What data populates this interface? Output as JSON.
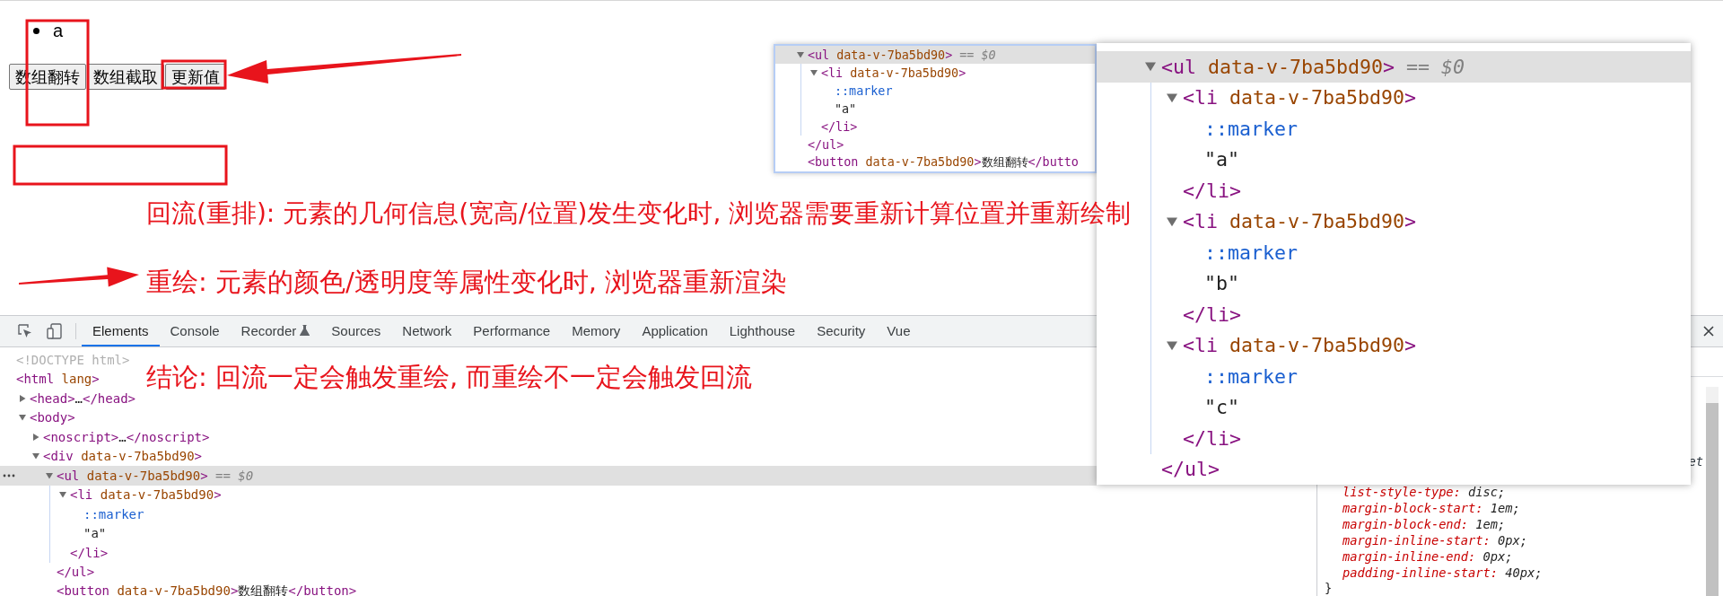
{
  "page": {
    "list_items": [
      "a"
    ],
    "buttons": [
      "数组翻转",
      "数组截取",
      "更新值"
    ]
  },
  "annotations": [
    "回流(重排): 元素的几何信息(宽高/位置)发生变化时, 浏览器需要重新计算位置并重新绘制",
    "重绘: 元素的颜色/透明度等属性变化时, 浏览器重新渲染",
    "结论: 回流一定会触发重绘, 而重绘不一定会触发回流"
  ],
  "devtools": {
    "tabs": [
      {
        "label": "Elements",
        "selected": true,
        "kind": "plain"
      },
      {
        "label": "Console",
        "selected": false,
        "kind": "plain"
      },
      {
        "label": "Recorder",
        "selected": false,
        "kind": "experiment"
      },
      {
        "label": "Sources",
        "selected": false,
        "kind": "plain"
      },
      {
        "label": "Network",
        "selected": false,
        "kind": "plain"
      },
      {
        "label": "Performance",
        "selected": false,
        "kind": "plain"
      },
      {
        "label": "Memory",
        "selected": false,
        "kind": "plain"
      },
      {
        "label": "Application",
        "selected": false,
        "kind": "plain"
      },
      {
        "label": "Lighthouse",
        "selected": false,
        "kind": "plain"
      },
      {
        "label": "Security",
        "selected": false,
        "kind": "plain"
      },
      {
        "label": "Vue",
        "selected": false,
        "kind": "plain"
      }
    ],
    "dom_tree": [
      {
        "open": [
          {
            "kind": "doctype",
            "text": "<!DOCTYPE html>"
          }
        ],
        "selected": false
      },
      {
        "open": [
          {
            "kind": "tag",
            "text": "<html"
          },
          {
            "kind": "attr",
            "text": " lang"
          },
          {
            "kind": "tag",
            "text": ">"
          }
        ],
        "selected": false,
        "children": [
          {
            "open": [
              {
                "kind": "tag",
                "text": "<head>"
              },
              {
                "kind": "text",
                "text": "…"
              },
              {
                "kind": "tag",
                "text": "</head>"
              }
            ],
            "expanded": false,
            "selected": false
          },
          {
            "open": [
              {
                "kind": "tag",
                "text": "<body>"
              }
            ],
            "expanded": true,
            "selected": false,
            "children": [
              {
                "open": [
                  {
                    "kind": "tag",
                    "text": "<noscript>"
                  },
                  {
                    "kind": "text",
                    "text": "…"
                  },
                  {
                    "kind": "tag",
                    "text": "</noscript>"
                  }
                ],
                "expanded": false,
                "selected": false
              },
              {
                "open": [
                  {
                    "kind": "tag",
                    "text": "<div"
                  },
                  {
                    "kind": "attr",
                    "text": " data-v-7ba5bd90"
                  },
                  {
                    "kind": "tag",
                    "text": ">"
                  }
                ],
                "expanded": true,
                "selected": false,
                "children": [
                  {
                    "open": [
                      {
                        "kind": "tag",
                        "text": "<ul"
                      },
                      {
                        "kind": "attr",
                        "text": " data-v-7ba5bd90"
                      },
                      {
                        "kind": "tag",
                        "text": ">"
                      },
                      {
                        "kind": "hint",
                        "text": " == "
                      },
                      {
                        "kind": "var",
                        "text": "$0"
                      }
                    ],
                    "expanded": true,
                    "selected": true,
                    "more_button": true,
                    "children": [
                      {
                        "open": [
                          {
                            "kind": "tag",
                            "text": "<li"
                          },
                          {
                            "kind": "attr",
                            "text": " data-v-7ba5bd90"
                          },
                          {
                            "kind": "tag",
                            "text": ">"
                          }
                        ],
                        "expanded": true,
                        "selected": false,
                        "children": [
                          {
                            "open": [
                              {
                                "kind": "pseudo",
                                "text": "::marker"
                              }
                            ],
                            "selected": false
                          },
                          {
                            "open": [
                              {
                                "kind": "text",
                                "text": "\"a\""
                              }
                            ],
                            "selected": false
                          }
                        ],
                        "close": [
                          {
                            "kind": "tag",
                            "text": "</li>"
                          }
                        ]
                      }
                    ],
                    "close": [
                      {
                        "kind": "tag",
                        "text": "</ul>"
                      }
                    ]
                  },
                  {
                    "open": [
                      {
                        "kind": "tag",
                        "text": "<button"
                      },
                      {
                        "kind": "attr",
                        "text": " data-v-7ba5bd90"
                      },
                      {
                        "kind": "tag",
                        "text": ">"
                      },
                      {
                        "kind": "text",
                        "text": "数组翻转"
                      },
                      {
                        "kind": "tag",
                        "text": "</button>"
                      }
                    ],
                    "selected": false
                  }
                ]
              }
            ]
          }
        ]
      }
    ],
    "styles": {
      "source_fragment": "et",
      "declarations": [
        {
          "name": "list-style-type:",
          "value": "disc;"
        },
        {
          "name": "margin-block-start:",
          "value": "1em;"
        },
        {
          "name": "margin-block-end:",
          "value": "1em;"
        },
        {
          "name": "margin-inline-start:",
          "value": "0px;"
        },
        {
          "name": "margin-inline-end:",
          "value": "0px;"
        },
        {
          "name": "padding-inline-start:",
          "value": "40px;"
        }
      ],
      "closing": "}"
    }
  },
  "popups": [
    {
      "dom_tree": [
        {
          "open": [
            {
              "kind": "tag",
              "text": "<ul"
            },
            {
              "kind": "attr",
              "text": " data-v-7ba5bd90"
            },
            {
              "kind": "tag",
              "text": ">"
            },
            {
              "kind": "hint",
              "text": " == "
            },
            {
              "kind": "var",
              "text": "$0"
            }
          ],
          "expanded": true,
          "selected": true,
          "children": [
            {
              "open": [
                {
                  "kind": "tag",
                  "text": "<li"
                },
                {
                  "kind": "attr",
                  "text": " data-v-7ba5bd90"
                },
                {
                  "kind": "tag",
                  "text": ">"
                }
              ],
              "expanded": true,
              "selected": false,
              "children": [
                {
                  "open": [
                    {
                      "kind": "pseudo",
                      "text": "::marker"
                    }
                  ],
                  "selected": false
                },
                {
                  "open": [
                    {
                      "kind": "text",
                      "text": "\"a\""
                    }
                  ],
                  "selected": false
                }
              ],
              "close": [
                {
                  "kind": "tag",
                  "text": "</li>"
                }
              ]
            }
          ],
          "close": [
            {
              "kind": "tag",
              "text": "</ul>"
            }
          ]
        },
        {
          "open": [
            {
              "kind": "tag",
              "text": "<button"
            },
            {
              "kind": "attr",
              "text": " data-v-7ba5bd90"
            },
            {
              "kind": "tag",
              "text": ">"
            },
            {
              "kind": "text",
              "text": "数组翻转"
            },
            {
              "kind": "tag",
              "text": "</butto"
            }
          ],
          "selected": false
        }
      ]
    },
    {
      "dom_tree": [
        {
          "open": [
            {
              "kind": "tag",
              "text": "<ul"
            },
            {
              "kind": "attr",
              "text": " data-v-7ba5bd90"
            },
            {
              "kind": "tag",
              "text": ">"
            },
            {
              "kind": "hint",
              "text": " == "
            },
            {
              "kind": "var",
              "text": "$0"
            }
          ],
          "expanded": true,
          "selected": true,
          "children": [
            {
              "open": [
                {
                  "kind": "tag",
                  "text": "<li"
                },
                {
                  "kind": "attr",
                  "text": " data-v-7ba5bd90"
                },
                {
                  "kind": "tag",
                  "text": ">"
                }
              ],
              "expanded": true,
              "selected": false,
              "children": [
                {
                  "open": [
                    {
                      "kind": "pseudo",
                      "text": "::marker"
                    }
                  ],
                  "selected": false
                },
                {
                  "open": [
                    {
                      "kind": "text",
                      "text": "\"a\""
                    }
                  ],
                  "selected": false
                }
              ],
              "close": [
                {
                  "kind": "tag",
                  "text": "</li>"
                }
              ]
            },
            {
              "open": [
                {
                  "kind": "tag",
                  "text": "<li"
                },
                {
                  "kind": "attr",
                  "text": " data-v-7ba5bd90"
                },
                {
                  "kind": "tag",
                  "text": ">"
                }
              ],
              "expanded": true,
              "selected": false,
              "children": [
                {
                  "open": [
                    {
                      "kind": "pseudo",
                      "text": "::marker"
                    }
                  ],
                  "selected": false
                },
                {
                  "open": [
                    {
                      "kind": "text",
                      "text": "\"b\""
                    }
                  ],
                  "selected": false
                }
              ],
              "close": [
                {
                  "kind": "tag",
                  "text": "</li>"
                }
              ]
            },
            {
              "open": [
                {
                  "kind": "tag",
                  "text": "<li"
                },
                {
                  "kind": "attr",
                  "text": " data-v-7ba5bd90"
                },
                {
                  "kind": "tag",
                  "text": ">"
                }
              ],
              "expanded": true,
              "selected": false,
              "children": [
                {
                  "open": [
                    {
                      "kind": "pseudo",
                      "text": "::marker"
                    }
                  ],
                  "selected": false
                },
                {
                  "open": [
                    {
                      "kind": "text",
                      "text": "\"c\""
                    }
                  ],
                  "selected": false
                }
              ],
              "close": [
                {
                  "kind": "tag",
                  "text": "</li>"
                }
              ]
            }
          ],
          "close": [
            {
              "kind": "tag",
              "text": "</ul>"
            }
          ]
        }
      ]
    }
  ]
}
